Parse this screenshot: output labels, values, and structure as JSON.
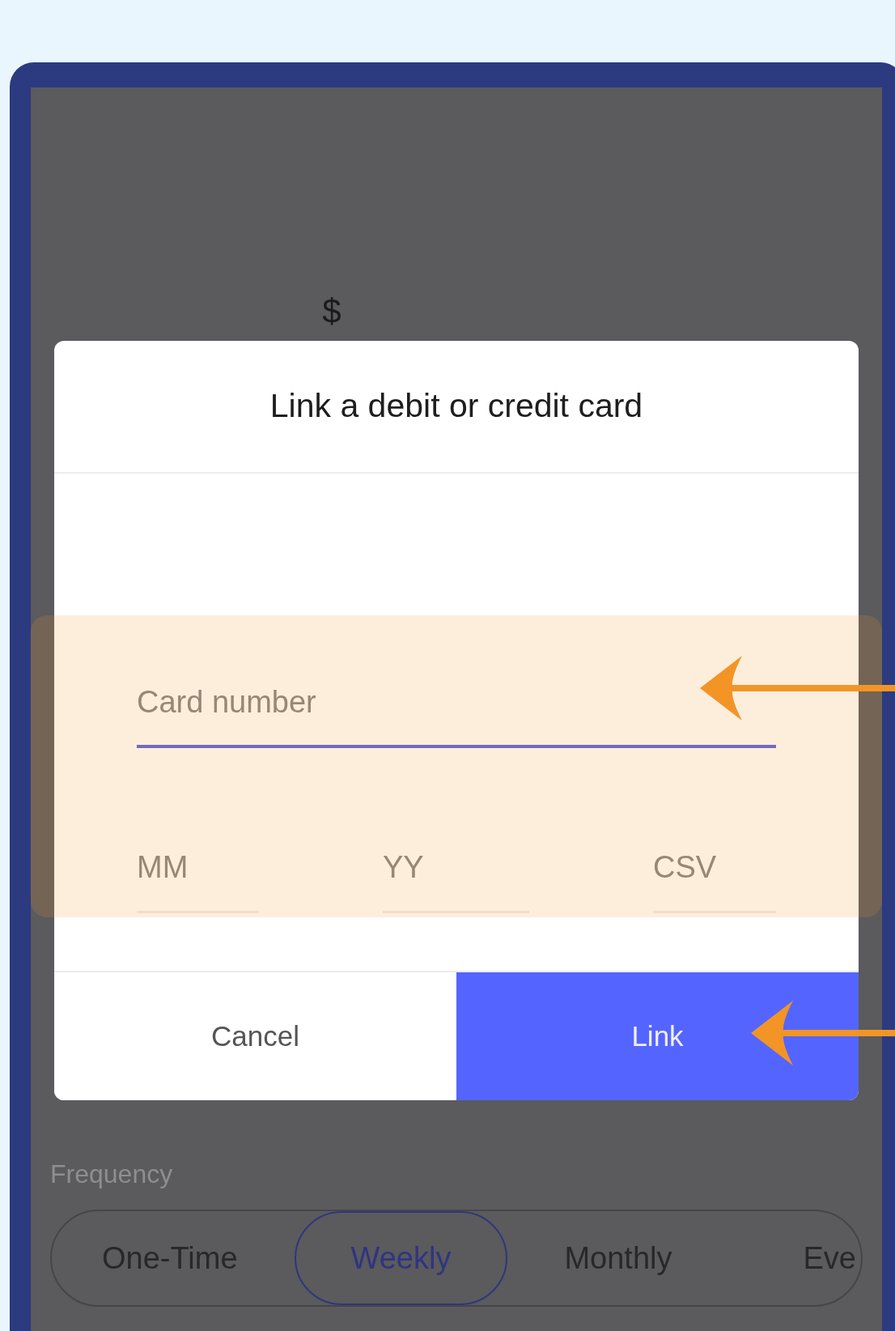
{
  "background_screen": {
    "currency": "$",
    "frequency": {
      "label": "Frequency",
      "options": [
        {
          "label": "One-Time",
          "selected": false
        },
        {
          "label": "Weekly",
          "selected": true
        },
        {
          "label": "Monthly",
          "selected": false
        },
        {
          "label": "Eve",
          "selected": false
        }
      ]
    }
  },
  "dialog": {
    "title": "Link a debit or credit card",
    "fields": [
      {
        "placeholder": "Card number",
        "focused": true
      },
      {
        "placeholder": "MM",
        "focused": false
      },
      {
        "placeholder": "YY",
        "focused": false
      },
      {
        "placeholder": "CSV",
        "focused": false
      }
    ],
    "buttons": [
      {
        "label": "Cancel",
        "kind": "secondary"
      },
      {
        "label": "Link",
        "kind": "primary"
      }
    ]
  }
}
